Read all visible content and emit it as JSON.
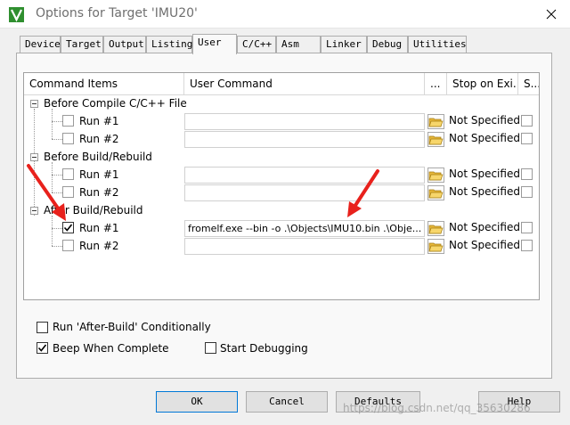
{
  "window": {
    "title": "Options for Target 'IMU20'"
  },
  "tabs": [
    {
      "label": "Device"
    },
    {
      "label": "Target"
    },
    {
      "label": "Output"
    },
    {
      "label": "Listing"
    },
    {
      "label": "User"
    },
    {
      "label": "C/C++"
    },
    {
      "label": "Asm"
    },
    {
      "label": "Linker"
    },
    {
      "label": "Debug"
    },
    {
      "label": "Utilities"
    }
  ],
  "grid": {
    "headers": {
      "items": "Command Items",
      "command": "User Command",
      "browse": "...",
      "stop": "Stop on Exi...",
      "s": "S..."
    },
    "groups": [
      {
        "label": "Before Compile C/C++ File",
        "rows": [
          {
            "label": "Run #1",
            "checked": false,
            "command": "",
            "stop": "Not Specified"
          },
          {
            "label": "Run #2",
            "checked": false,
            "command": "",
            "stop": "Not Specified"
          }
        ]
      },
      {
        "label": "Before Build/Rebuild",
        "rows": [
          {
            "label": "Run #1",
            "checked": false,
            "command": "",
            "stop": "Not Specified"
          },
          {
            "label": "Run #2",
            "checked": false,
            "command": "",
            "stop": "Not Specified"
          }
        ]
      },
      {
        "label": "After Build/Rebuild",
        "rows": [
          {
            "label": "Run #1",
            "checked": true,
            "command": "fromelf.exe --bin -o .\\Objects\\IMU10.bin  .\\Obje...",
            "stop": "Not Specified"
          },
          {
            "label": "Run #2",
            "checked": false,
            "command": "",
            "stop": "Not Specified"
          }
        ]
      }
    ]
  },
  "options": {
    "run_after_build": {
      "label": "Run 'After-Build' Conditionally",
      "checked": false
    },
    "beep": {
      "label": "Beep When Complete",
      "checked": true
    },
    "start_debug": {
      "label": "Start Debugging",
      "checked": false
    }
  },
  "buttons": {
    "ok": "OK",
    "cancel": "Cancel",
    "defaults": "Defaults",
    "help": "Help"
  },
  "watermark": "https://blog.csdn.net/qq_35630286",
  "colors": {
    "arrow": "#e8211c",
    "focus": "#0078d7",
    "check": "#000000"
  }
}
